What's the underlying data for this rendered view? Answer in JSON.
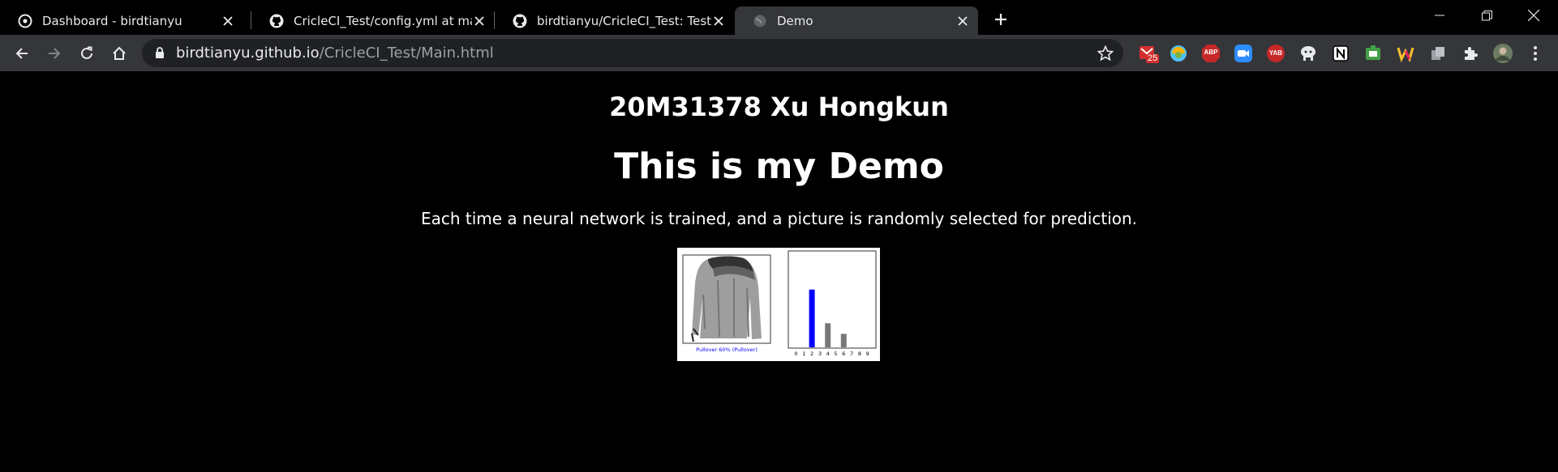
{
  "browser": {
    "tabs": [
      {
        "title": "Dashboard - birdtianyu",
        "icon": "circleci-icon",
        "active": false
      },
      {
        "title": "CricleCI_Test/config.yml at ma",
        "icon": "github-icon",
        "active": false
      },
      {
        "title": "birdtianyu/CricleCI_Test: Test f",
        "icon": "github-icon",
        "active": false
      },
      {
        "title": "Demo",
        "icon": "globe-icon",
        "active": true
      }
    ],
    "url_host": "birdtianyu.github.io",
    "url_path": "/CricleCI_Test/Main.html",
    "extensions": [
      {
        "name": "mail-extension-icon",
        "badge": "25",
        "color": "#d32f2f"
      },
      {
        "name": "colorful-bird-extension-icon",
        "color": "#4fc3f7"
      },
      {
        "name": "adblock-plus-extension-icon",
        "label": "ABP",
        "color": "#c62828"
      },
      {
        "name": "zoom-extension-icon",
        "color": "#2d8cff"
      },
      {
        "name": "yab-extension-icon",
        "label": "YAB",
        "color": "#c62828"
      },
      {
        "name": "octocat-extension-icon",
        "color": "#e8eaed"
      },
      {
        "name": "notion-extension-icon",
        "color": "#ffffff"
      },
      {
        "name": "screenshot-extension-icon",
        "color": "#43a047"
      },
      {
        "name": "w-extension-icon",
        "color": "#fbc02d"
      },
      {
        "name": "copy-extension-icon",
        "color": "#9aa0a6"
      },
      {
        "name": "extensions-puzzle-icon",
        "color": "#e8eaed"
      },
      {
        "name": "profile-avatar",
        "color": "#6d7b62"
      }
    ]
  },
  "page": {
    "author": "20M31378 Xu Hongkun",
    "heading": "This is my Demo",
    "description": "Each time a neural network is trained, and a picture is randomly selected for prediction.",
    "prediction_caption": "Pullover 60% (Pullover)",
    "prediction_ticks": [
      "0",
      "1",
      "2",
      "3",
      "4",
      "5",
      "6",
      "7",
      "8",
      "9"
    ],
    "prediction_probs": [
      0,
      0,
      0.6,
      0,
      0.25,
      0,
      0.14,
      0,
      0,
      0
    ],
    "predicted_index": 2,
    "predicted_color": "#0000ff",
    "other_color": "#777777"
  }
}
